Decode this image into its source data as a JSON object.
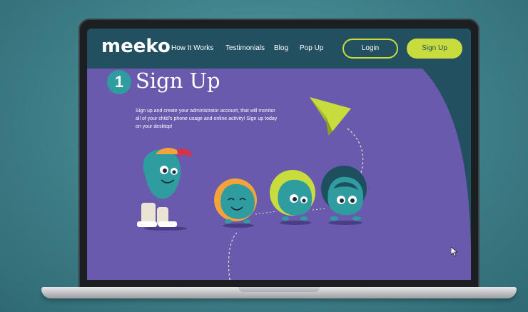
{
  "site": {
    "logo": "meeko"
  },
  "nav": {
    "links": [
      "How It Works",
      "Testimonials",
      "Blog",
      "Pop Up"
    ],
    "login_label": "Login",
    "signup_label": "Sign Up"
  },
  "step": {
    "number": "1",
    "title": "Sign Up",
    "description": "Sign up and create your administrator account, that will monitor all of your child's phone usage and online activity! Sign up today on your desktop!"
  },
  "colors": {
    "nav_bg": "#235061",
    "accent_lime": "#c9dc3d",
    "content_purple": "#6a5aad",
    "teal": "#2f9ca0",
    "orange": "#f4a23a"
  },
  "icons": [
    "paper-plane-icon",
    "mouse-cursor-icon"
  ]
}
